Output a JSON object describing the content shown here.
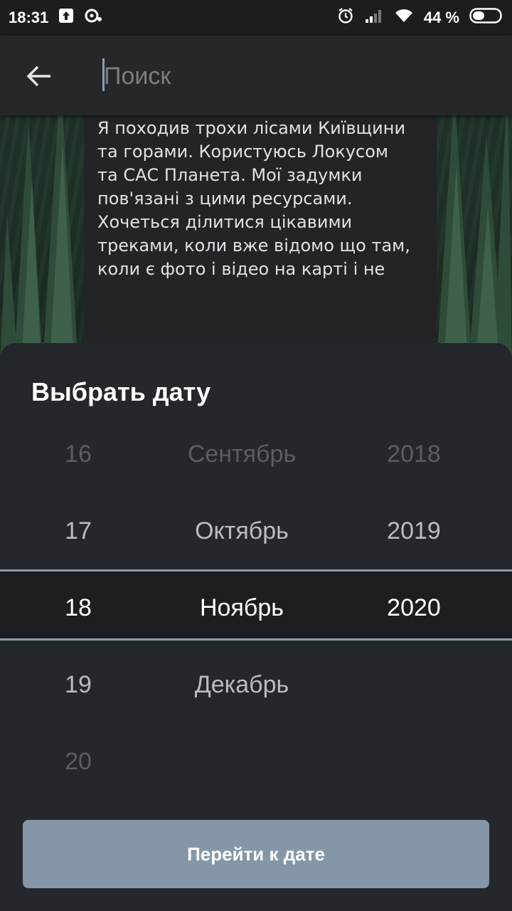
{
  "status_bar": {
    "time": "18:31",
    "battery_percent": "44 %",
    "icons": [
      "upload-icon",
      "media-icon",
      "alarm-icon",
      "signal-icon",
      "wifi-icon",
      "battery-icon"
    ]
  },
  "search": {
    "placeholder": "Поиск",
    "value": ""
  },
  "article": {
    "text": "що це дофамінова залежність.\nІ результат вашої роботи міняє\nжиття на краще.\n\nЯ походив трохи лісами Київщини\nта горами. Користуюсь Локусом\nта САС Планета. Мої задумки\nпов'язані з цими ресурсами.\nХочеться ділитися цікавими\nтреками, коли вже відомо що там,\nколи є фото і відео на карті і не"
  },
  "date_picker": {
    "title": "Выбрать дату",
    "days": [
      "16",
      "17",
      "18",
      "19",
      "20"
    ],
    "months": [
      "Сентябрь",
      "Октябрь",
      "Ноябрь",
      "Декабрь"
    ],
    "years": [
      "2018",
      "2019",
      "2020"
    ],
    "selected": {
      "day": "18",
      "month": "Ноябрь",
      "year": "2020"
    },
    "button_label": "Перейти к дате"
  },
  "colors": {
    "sheet_bg": "#24272b",
    "selection_line": "#8a9aa8",
    "button_bg": "#8597a6",
    "appbar_bg": "#262729"
  }
}
